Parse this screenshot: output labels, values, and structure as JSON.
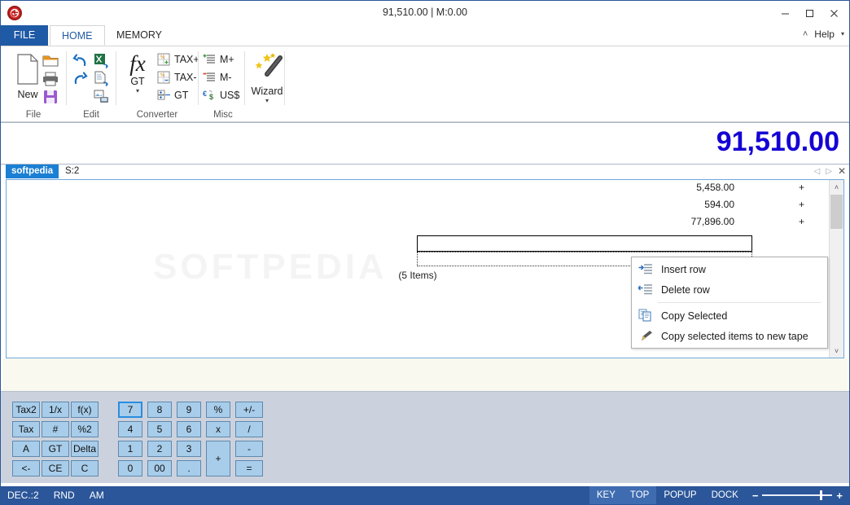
{
  "window": {
    "title": "91,510.00 | M:0.00",
    "logo_icon": "calculator-app-logo",
    "minimize": "─",
    "maximize": "☐",
    "close": "✕"
  },
  "tabs": {
    "file": "FILE",
    "home": "HOME",
    "memory": "MEMORY",
    "help": "Help",
    "help_caret": "▾",
    "collapse_caret": "˄"
  },
  "ribbon": {
    "groups": [
      {
        "label": "File"
      },
      {
        "label": "Edit"
      },
      {
        "label": "Converter"
      },
      {
        "label": "Misc"
      }
    ],
    "file": {
      "new_label": "New",
      "new_icon": "new-document-icon",
      "open_icon": "open-folder-icon",
      "print_icon": "printer-icon",
      "save_icon": "save-floppy-icon"
    },
    "edit": {
      "undo_icon": "undo-arrow-icon",
      "redo_icon": "redo-arrow-icon",
      "export_excel_icon": "export-excel-icon",
      "export_doc_icon": "export-document-icon",
      "export_screen_icon": "export-screen-icon"
    },
    "converter": {
      "fx_label": "fx",
      "gt_label": "GT",
      "gt_caret": "▾",
      "taxplus_label": "TAX+",
      "taxminus_label": "TAX-",
      "gt_row_label": "GT",
      "taxplus_icon": "tax-plus-icon",
      "taxminus_icon": "tax-minus-icon",
      "gt_icon": "grand-total-icon"
    },
    "misc": {
      "mplus_label": "M+",
      "mminus_label": "M-",
      "us_label": "US$",
      "mplus_icon": "memory-plus-icon",
      "mminus_icon": "memory-minus-icon",
      "currency_icon": "currency-convert-icon",
      "wizard_label": "Wizard",
      "wizard_icon": "magic-wand-icon",
      "wizard_caret": "▾"
    }
  },
  "display": {
    "value": "91,510.00"
  },
  "tape": {
    "tab_active": "softpedia",
    "tab_second": "S:2",
    "nav_prev": "◁",
    "nav_next": "▷",
    "nav_close": "✕",
    "watermark": "SOFTPEDIA",
    "items_label": "(5 Items)",
    "rows": [
      {
        "value": "5,458.00",
        "op": "+"
      },
      {
        "value": "594.00",
        "op": "+"
      },
      {
        "value": "77,896.00",
        "op": "+"
      },
      {
        "value": "",
        "op": ""
      },
      {
        "value": "",
        "op": ""
      }
    ],
    "edit_value": "",
    "scroll_up": "˄",
    "scroll_down": "˅"
  },
  "context_menu": {
    "items": [
      {
        "label": "Insert row",
        "icon": "insert-row-icon"
      },
      {
        "label": "Delete row",
        "icon": "delete-row-icon"
      },
      {
        "label": "Copy Selected",
        "icon": "copy-icon"
      },
      {
        "label": "Copy selected items to new tape",
        "icon": "copy-to-tape-icon"
      }
    ]
  },
  "keypad": {
    "left_keys": [
      [
        "Tax2",
        "1/x",
        "f(x)"
      ],
      [
        "Tax",
        "#",
        "%2"
      ],
      [
        "A",
        "GT",
        "Delta"
      ],
      [
        "<-",
        "CE",
        "C"
      ]
    ],
    "num_keys": [
      [
        "7",
        "8",
        "9",
        "%",
        "+/-"
      ],
      [
        "4",
        "5",
        "6",
        "x",
        "/"
      ],
      [
        "1",
        "2",
        "3",
        "+",
        "-"
      ],
      [
        "0",
        "00",
        ".",
        "",
        "="
      ]
    ],
    "focused_key": "7"
  },
  "statusbar": {
    "dec": "DEC.:2",
    "rnd": "RND",
    "am": "AM",
    "key": "KEY",
    "top": "TOP",
    "popup": "POPUP",
    "dock": "DOCK",
    "minus": "−",
    "plus": "+"
  },
  "colors": {
    "accent": "#2b5699",
    "display_value": "#1400d4",
    "tape_tab_active": "#1b7fd4",
    "key_face": "#a8cdea",
    "keypad_bg": "#ccd2dd",
    "beige_strip": "#faf9ef"
  }
}
